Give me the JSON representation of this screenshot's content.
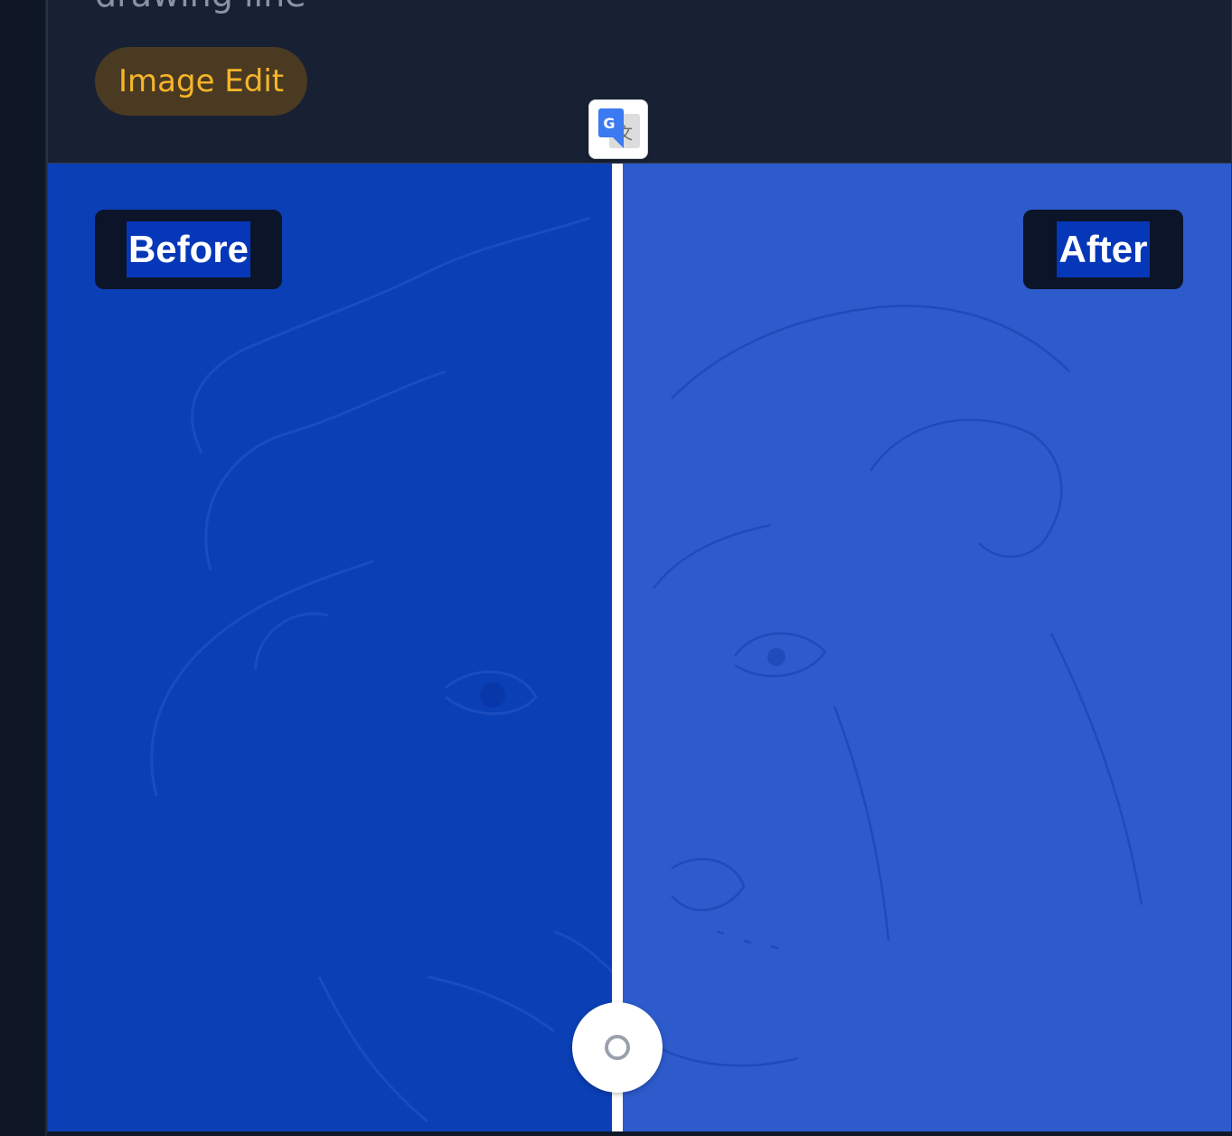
{
  "card": {
    "title": "drawing line",
    "tag": "Image Edit"
  },
  "comparison": {
    "before_label": "Before",
    "after_label": "After",
    "slider_position_percent": 48.5,
    "colors": {
      "before_overlay": "#0a3fb5",
      "after_overlay": "#2d5bcc",
      "label_bg": "#0b1428",
      "tag_bg": "#4a3a22",
      "tag_text": "#f6b52a"
    }
  },
  "icons": {
    "translate": "google-translate-icon",
    "handle": "slider-handle-icon"
  }
}
